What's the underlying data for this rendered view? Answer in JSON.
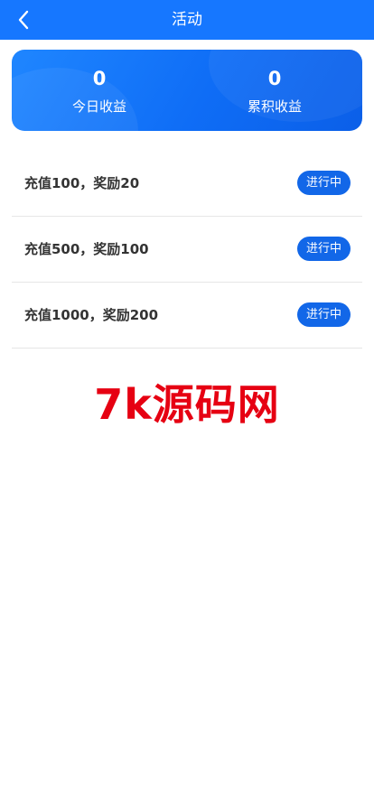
{
  "header": {
    "title": "活动",
    "back_icon": "chevron-left-icon",
    "background": "#1677ff"
  },
  "stats": {
    "today": {
      "value": "0",
      "label": "今日收益"
    },
    "total": {
      "value": "0",
      "label": "累积收益"
    }
  },
  "activities": [
    {
      "title": "充值100，奖励20",
      "status": "进行中"
    },
    {
      "title": "充值500，奖励100",
      "status": "进行中"
    },
    {
      "title": "充值1000，奖励200",
      "status": "进行中"
    }
  ],
  "watermark": {
    "text": "7k源码网",
    "color": "#e60012"
  },
  "colors": {
    "accent": "#1267e8",
    "card": "#0f6df6"
  }
}
